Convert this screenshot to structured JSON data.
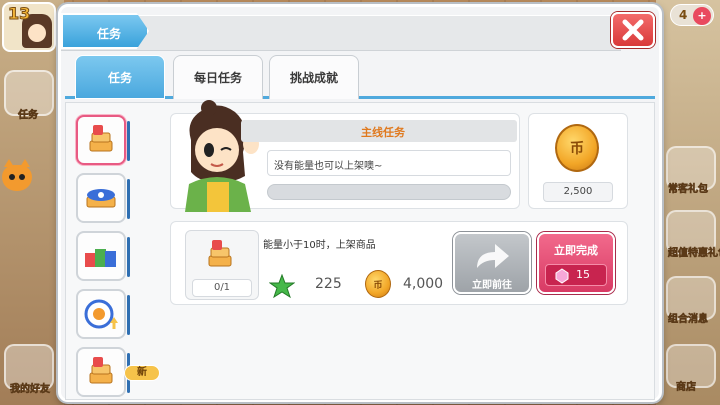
{
  "hud": {
    "level": "13",
    "left_side_label": "任务",
    "left_bottom_label": "我的好友",
    "right_top_count": "4",
    "right_labels": [
      "常客礼包",
      "超值特惠礼包",
      "组合消息",
      "商店"
    ]
  },
  "dialog": {
    "title": "任务",
    "tabs": [
      {
        "label": "任务",
        "active": true
      },
      {
        "label": "每日任务",
        "active": false
      },
      {
        "label": "挑战成就",
        "active": false
      }
    ],
    "new_badge": "新",
    "main_task": {
      "header": "主线任务",
      "description": "没有能量也可以上架噢~",
      "progress": 0,
      "reward_amount": "2,500",
      "reward_coin_glyph": "币"
    },
    "sub_task": {
      "description": "能量小于10时，上架商品",
      "count": "0/1",
      "exp": "225",
      "gold": "4,000",
      "coin_glyph": "币",
      "goto_label": "立即前往",
      "complete_label": "立即完成",
      "complete_cost": "15"
    }
  },
  "colors": {
    "accent": "#4aa8de",
    "close": "#d93a3a",
    "complete": "#d83a64",
    "header_text": "#e0791e"
  }
}
